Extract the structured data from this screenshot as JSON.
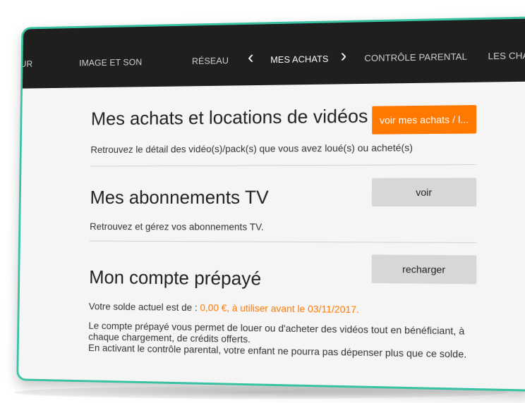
{
  "nav": {
    "items": [
      "UR",
      "IMAGE ET SON",
      "RÉSEAU",
      "MES ACHATS",
      "CONTRÔLE PARENTAL",
      "LES CHAÎNES"
    ],
    "active_index": 3,
    "prev_arrow": "‹",
    "next_arrow": "›"
  },
  "purchases": {
    "title": "Mes achats et locations de vidéos",
    "button_label": "voir mes achats / l...",
    "description": "Retrouvez le détail des vidéo(s)/pack(s) que vous avez loué(s) ou acheté(s)"
  },
  "subscriptions": {
    "title": "Mes abonnements TV",
    "button_label": "voir",
    "description": "Retrouvez et gérez vos abonnements TV."
  },
  "prepaid": {
    "title": "Mon compte prépayé",
    "button_label": "recharger",
    "balance_prefix": "Votre solde actuel est de : ",
    "balance_value": "0,00 €, à utiliser avant le 03/11/2017.",
    "info_line_1": "Le compte prépayé vous permet de louer ou d'acheter des vidéos tout en bénéficiant, à",
    "info_line_2": "chaque chargement, de crédits offerts.",
    "info_line_3": "En activant le contrôle parental, votre enfant ne pourra pas dépenser plus que ce solde."
  },
  "colors": {
    "accent": "#ff7900",
    "frame": "#39c3a4",
    "nav_background": "#1f1f1f",
    "screen_background": "#f5f5f5",
    "grey_button": "#d7d7d7"
  }
}
